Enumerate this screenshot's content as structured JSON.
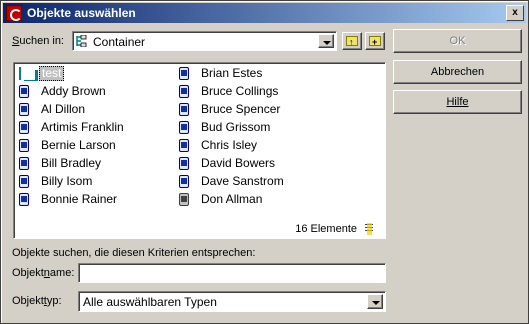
{
  "window": {
    "title": "Objekte auswählen",
    "close_glyph": "x"
  },
  "search_in": {
    "label": "Suchen in:",
    "value": "Container"
  },
  "toolbar": {
    "up_icon": "folder-up-icon",
    "new_icon": "folder-new-icon"
  },
  "list": {
    "items": [
      {
        "label": "test",
        "type": "container",
        "selected": true
      },
      {
        "label": "Addy Brown",
        "type": "user"
      },
      {
        "label": "Al Dillon",
        "type": "user"
      },
      {
        "label": "Artimis Franklin",
        "type": "user"
      },
      {
        "label": "Bernie Larson",
        "type": "user"
      },
      {
        "label": "Bill Bradley",
        "type": "user"
      },
      {
        "label": "Billy Isom",
        "type": "user"
      },
      {
        "label": "Bonnie Rainer",
        "type": "user"
      },
      {
        "label": "Brian Estes",
        "type": "user"
      },
      {
        "label": "Bruce Collings",
        "type": "user"
      },
      {
        "label": "Bruce Spencer",
        "type": "user"
      },
      {
        "label": "Bud Grissom",
        "type": "user"
      },
      {
        "label": "Chris Isley",
        "type": "user"
      },
      {
        "label": "David Bowers",
        "type": "user"
      },
      {
        "label": "Dave Sanstrom",
        "type": "user"
      },
      {
        "label": "Don Allman",
        "type": "user-disabled"
      }
    ],
    "count_text": "16 Elemente"
  },
  "buttons": {
    "ok": "OK",
    "cancel": "Abbrechen",
    "help": "Hilfe"
  },
  "criteria": {
    "heading": "Objekte suchen, die diesen Kriterien entsprechen:",
    "name_label_pre": "Objekt",
    "name_label_ul": "n",
    "name_label_post": "ame:",
    "name_value": "",
    "type_label_pre": "Objekt",
    "type_label_ul": "t",
    "type_label_post": "yp:",
    "type_value": "Alle auswählbaren Typen"
  }
}
